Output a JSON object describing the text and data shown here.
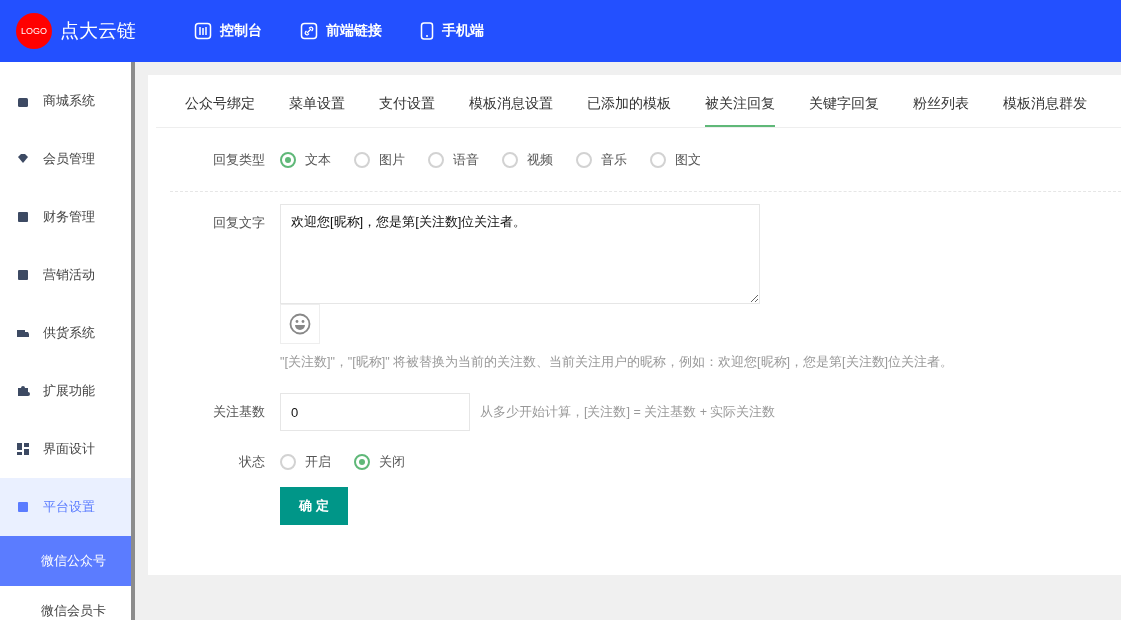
{
  "header": {
    "logo": "LOGO",
    "brand": "点大云链",
    "nav": [
      {
        "label": "控制台"
      },
      {
        "label": "前端链接"
      },
      {
        "label": "手机端"
      }
    ]
  },
  "sidebar": {
    "items": [
      {
        "label": "商城系统",
        "selected": false
      },
      {
        "label": "会员管理",
        "selected": false
      },
      {
        "label": "财务管理",
        "selected": false
      },
      {
        "label": "营销活动",
        "selected": false
      },
      {
        "label": "供货系统",
        "selected": false
      },
      {
        "label": "扩展功能",
        "selected": false
      },
      {
        "label": "界面设计",
        "selected": false
      },
      {
        "label": "平台设置",
        "selected": true,
        "children": [
          {
            "label": "微信公众号",
            "selected": true
          },
          {
            "label": "微信会员卡",
            "selected": false
          }
        ]
      }
    ]
  },
  "tabs": [
    {
      "label": "公众号绑定",
      "selected": false
    },
    {
      "label": "菜单设置",
      "selected": false
    },
    {
      "label": "支付设置",
      "selected": false
    },
    {
      "label": "模板消息设置",
      "selected": false
    },
    {
      "label": "已添加的模板",
      "selected": false
    },
    {
      "label": "被关注回复",
      "selected": true
    },
    {
      "label": "关键字回复",
      "selected": false
    },
    {
      "label": "粉丝列表",
      "selected": false
    },
    {
      "label": "模板消息群发",
      "selected": false
    }
  ],
  "form": {
    "reply_type": {
      "label": "回复类型",
      "options": [
        {
          "label": "文本",
          "selected": true
        },
        {
          "label": "图片",
          "selected": false
        },
        {
          "label": "语音",
          "selected": false
        },
        {
          "label": "视频",
          "selected": false
        },
        {
          "label": "音乐",
          "selected": false
        },
        {
          "label": "图文",
          "selected": false
        }
      ]
    },
    "reply_text": {
      "label": "回复文字",
      "value": "欢迎您[昵称]，您是第[关注数]位关注者。",
      "hint": "\"[关注数]\"，\"[昵称]\" 将被替换为当前的关注数、当前关注用户的昵称，例如：欢迎您[昵称]，您是第[关注数]位关注者。"
    },
    "base_count": {
      "label": "关注基数",
      "value": "0",
      "hint": "从多少开始计算，[关注数] = 关注基数 + 实际关注数"
    },
    "status": {
      "label": "状态",
      "options": [
        {
          "label": "开启",
          "selected": false
        },
        {
          "label": "关闭",
          "selected": true
        }
      ]
    },
    "submit": "确 定"
  }
}
